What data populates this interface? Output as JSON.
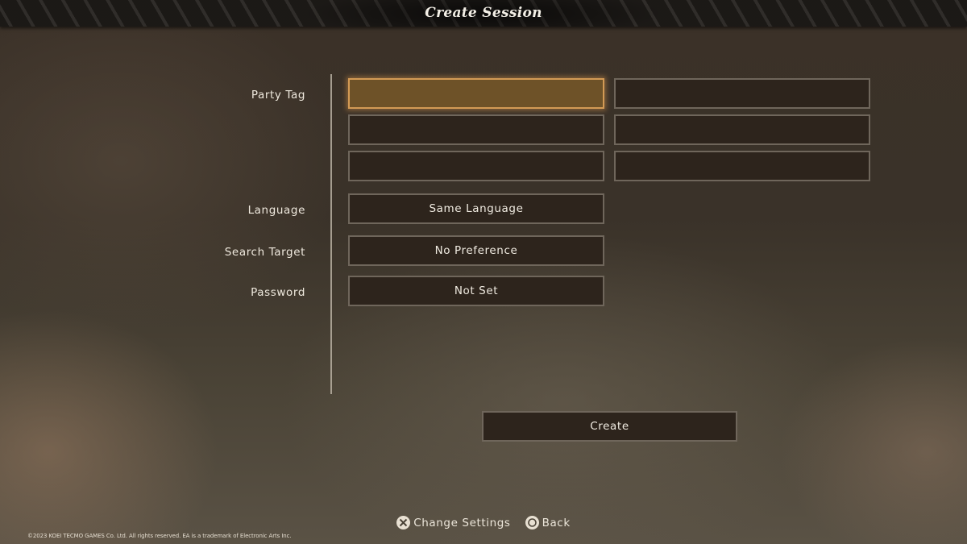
{
  "header": {
    "title": "Create Session"
  },
  "form": {
    "party_tag": {
      "label": "Party Tag",
      "slots": [
        "",
        "",
        "",
        "",
        "",
        ""
      ]
    },
    "language": {
      "label": "Language",
      "value": "Same Language"
    },
    "search_target": {
      "label": "Search Target",
      "value": "No Preference"
    },
    "password": {
      "label": "Password",
      "value": "Not Set"
    },
    "create_label": "Create"
  },
  "footer": {
    "hints": [
      {
        "icon": "cross-button-icon",
        "label": "Change Settings"
      },
      {
        "icon": "circle-button-icon",
        "label": "Back"
      }
    ],
    "copyright": "©2023 KOEI TECMO GAMES Co. Ltd. All rights reserved. EA is a trademark of Electronic Arts Inc."
  },
  "colors": {
    "focus": "#6e5228",
    "focus_border": "#d39a55",
    "field": "#2d241c"
  }
}
